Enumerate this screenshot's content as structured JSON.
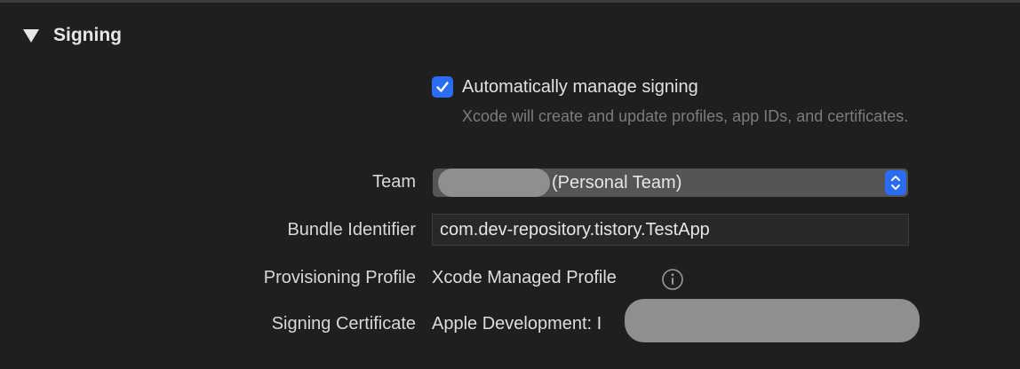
{
  "section": {
    "title": "Signing"
  },
  "auto_signing": {
    "label": "Automatically manage signing",
    "description": "Xcode will create and update profiles, app IDs, and certificates.",
    "checked": true,
    "accent_color": "#2a6df4"
  },
  "team": {
    "label": "Team",
    "value": "(Personal Team)"
  },
  "bundle_identifier": {
    "label": "Bundle Identifier",
    "value": "com.dev-repository.tistory.TestApp"
  },
  "provisioning_profile": {
    "label": "Provisioning Profile",
    "value": "Xcode Managed Profile",
    "icon": "info-icon"
  },
  "signing_certificate": {
    "label": "Signing Certificate",
    "value": "Apple Development: I"
  }
}
